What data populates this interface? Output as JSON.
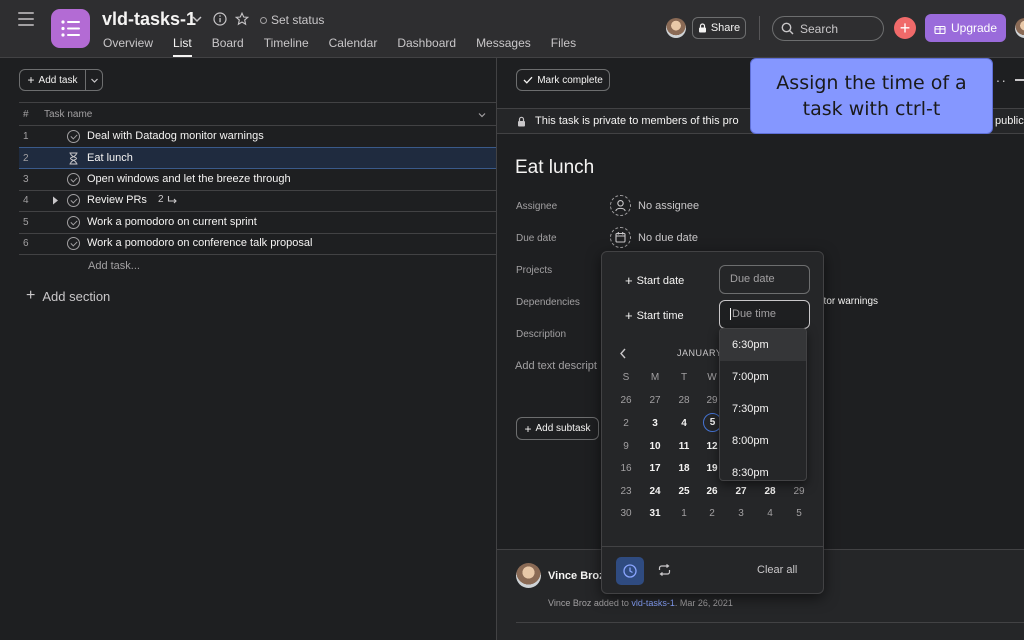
{
  "header": {
    "project_title": "vld-tasks-1",
    "set_status": "Set status",
    "tabs": [
      "Overview",
      "List",
      "Board",
      "Timeline",
      "Calendar",
      "Dashboard",
      "Messages",
      "Files"
    ],
    "active_tab": "List",
    "share": "Share",
    "search_placeholder": "Search",
    "upgrade": "Upgrade"
  },
  "list": {
    "add_task": "Add task",
    "col_num": "#",
    "col_task_name": "Task name",
    "rows": [
      {
        "num": "1",
        "name": "Deal with Datadog monitor warnings"
      },
      {
        "num": "2",
        "name": "Eat lunch"
      },
      {
        "num": "3",
        "name": "Open windows and let the breeze through"
      },
      {
        "num": "4",
        "name": "Review PRs",
        "subtasks": "2"
      },
      {
        "num": "5",
        "name": "Work a pomodoro on current sprint"
      },
      {
        "num": "6",
        "name": "Work a pomodoro on conference talk proposal"
      }
    ],
    "add_task_link": "Add task...",
    "add_section": "Add section"
  },
  "detail": {
    "mark_complete": "Mark complete",
    "private_notice": "This task is private to members of this pro",
    "private_tail": "public",
    "title": "Eat lunch",
    "fields": {
      "assignee_label": "Assignee",
      "assignee_value": "No assignee",
      "due_label": "Due date",
      "due_value": "No due date",
      "projects_label": "Projects",
      "dependencies_label": "Dependencies",
      "dependencies_value": "ntor warnings",
      "description_label": "Description",
      "description_placeholder": "Add text descript"
    },
    "add_subtask": "Add subtask",
    "activity_user": "Vince Broz",
    "activity_prefix": "Vince Broz added to ",
    "activity_project": "vld-tasks-1",
    "activity_suffix": ".  Mar 26, 2021"
  },
  "tooltip": {
    "line1": "Assign the time of a",
    "line2": "task with ctrl-t"
  },
  "date_popover": {
    "start_date": "Start date",
    "due_date_placeholder": "Due date",
    "start_time": "Start time",
    "due_time_placeholder": "Due time",
    "month_label": "JANUARY",
    "weekdays": [
      "S",
      "M",
      "T",
      "W"
    ],
    "weeks": [
      [
        "26",
        "27",
        "28",
        "29"
      ],
      [
        "2",
        "3",
        "4",
        "5"
      ],
      [
        "9",
        "10",
        "11",
        "12"
      ],
      [
        "16",
        "17",
        "18",
        "19"
      ],
      [
        "23",
        "24",
        "25",
        "26",
        "27",
        "28",
        "29"
      ],
      [
        "30",
        "31",
        "1",
        "2",
        "3",
        "4",
        "5"
      ]
    ],
    "clear_all": "Clear all",
    "time_options": [
      "6:30pm",
      "7:00pm",
      "7:30pm",
      "8:00pm",
      "8:30pm"
    ]
  },
  "colors": {
    "accent": "#4573d2",
    "project_icon": "#b36bd4",
    "upgrade": "#9a6bdb",
    "add_button": "#f06a6a",
    "tooltip_bg": "#8597ff"
  }
}
